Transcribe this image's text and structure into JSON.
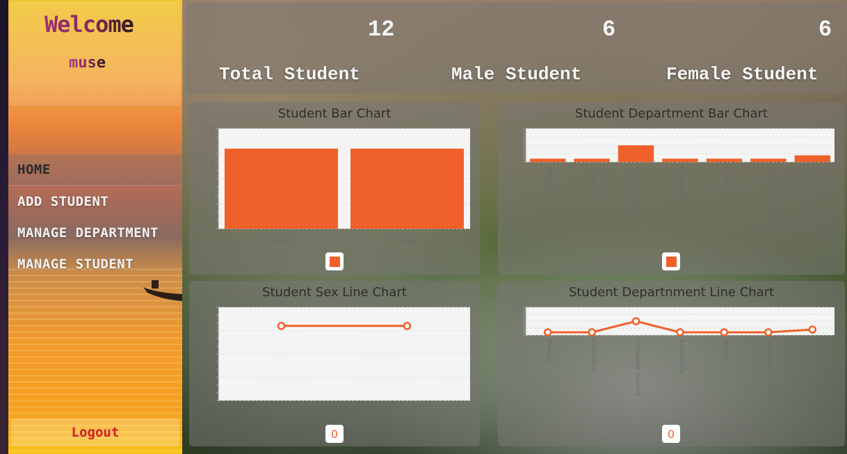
{
  "sidebar": {
    "welcome": "Welcome",
    "username": "muse",
    "nav": [
      {
        "label": "HOME"
      },
      {
        "label": "ADD STUDENT"
      },
      {
        "label": "MANAGE DEPARTMENT"
      },
      {
        "label": "MANAGE STUDENT"
      }
    ],
    "logout": "Logout"
  },
  "stats": [
    {
      "value": "12",
      "label": "Total Student"
    },
    {
      "value": "6",
      "label": "Male Student"
    },
    {
      "value": "6",
      "label": "Female Student"
    }
  ],
  "colors": {
    "accent": "#f0602a"
  },
  "cards": {
    "sex_bar": {
      "title": "Student Bar Chart"
    },
    "dept_bar": {
      "title": "Student Department Bar Chart"
    },
    "sex_line": {
      "title": "Student Sex Line Chart",
      "legend": "0"
    },
    "dept_line": {
      "title": "Student Departnment Line Chart",
      "legend": "0"
    }
  },
  "chart_data": [
    {
      "type": "bar",
      "title": "Student Bar Chart",
      "categories": [
        "Male",
        "Female"
      ],
      "values": [
        6,
        6
      ],
      "ylim": [
        0,
        7.5
      ],
      "yticks": [
        "0.0",
        "2.5",
        "5.0",
        "7.5"
      ],
      "grid": true
    },
    {
      "type": "bar",
      "title": "Student Department Bar Chart",
      "categories": [
        "Biology",
        "Chemistry",
        "Computer Science",
        "Economics",
        "History",
        "Information Science",
        "Maths"
      ],
      "values": [
        1,
        1,
        5,
        1,
        1,
        1,
        2
      ],
      "ylim": [
        0,
        10
      ],
      "grid": true
    },
    {
      "type": "line",
      "title": "Student Sex Line Chart",
      "categories": [
        "Male",
        "Female"
      ],
      "values": [
        6,
        6
      ],
      "ylim": [
        0,
        7.5
      ],
      "yticks": [
        "0.0",
        "2.5",
        "5.0",
        "7.5"
      ],
      "grid": true
    },
    {
      "type": "line",
      "title": "Student Departnment Line Chart",
      "categories": [
        "Biology",
        "Chemistry",
        "Computer Science",
        "Economics",
        "History",
        "Information Science",
        "Maths"
      ],
      "values": [
        1,
        1,
        5,
        1,
        1,
        1,
        2
      ],
      "ylim": [
        0,
        10
      ],
      "yticks": [
        "10"
      ],
      "grid": true
    }
  ]
}
